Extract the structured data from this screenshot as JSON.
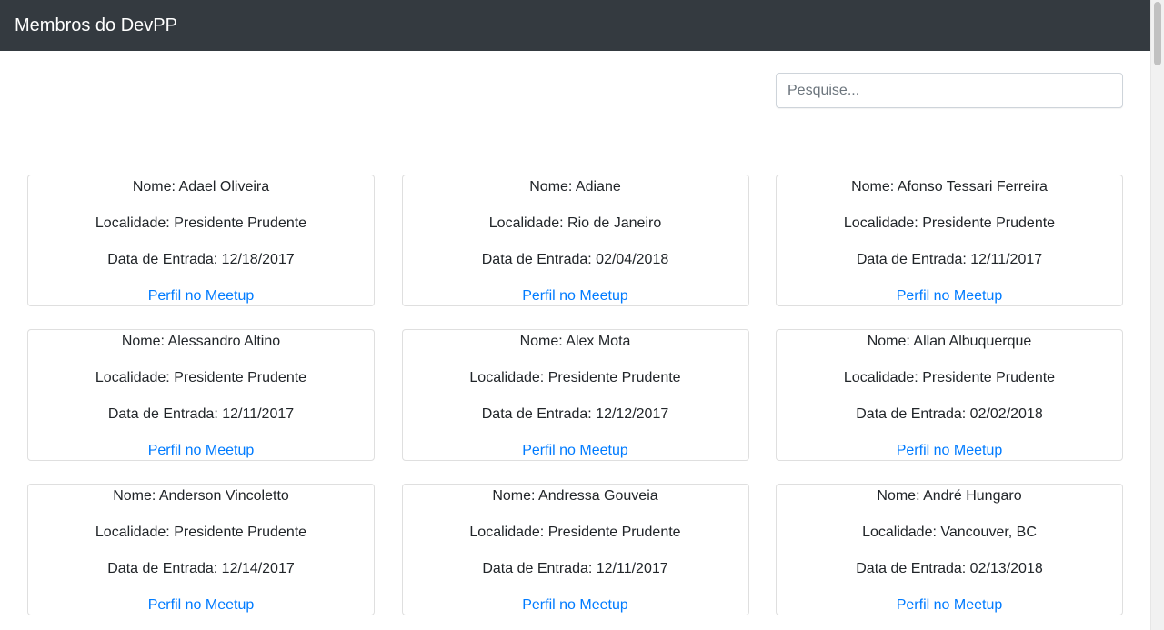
{
  "navbar": {
    "brand": "Membros do DevPP"
  },
  "search": {
    "placeholder": "Pesquise..."
  },
  "members": [
    {
      "name": "Nome: Adael Oliveira",
      "location": "Localidade: Presidente Prudente",
      "joined": "Data de Entrada: 12/18/2017",
      "link": "Perfil no Meetup"
    },
    {
      "name": "Nome: Adiane",
      "location": "Localidade: Rio de Janeiro",
      "joined": "Data de Entrada: 02/04/2018",
      "link": "Perfil no Meetup"
    },
    {
      "name": "Nome: Afonso Tessari Ferreira",
      "location": "Localidade: Presidente Prudente",
      "joined": "Data de Entrada: 12/11/2017",
      "link": "Perfil no Meetup"
    },
    {
      "name": "Nome: Alessandro Altino",
      "location": "Localidade: Presidente Prudente",
      "joined": "Data de Entrada: 12/11/2017",
      "link": "Perfil no Meetup"
    },
    {
      "name": "Nome: Alex Mota",
      "location": "Localidade: Presidente Prudente",
      "joined": "Data de Entrada: 12/12/2017",
      "link": "Perfil no Meetup"
    },
    {
      "name": "Nome: Allan Albuquerque",
      "location": "Localidade: Presidente Prudente",
      "joined": "Data de Entrada: 02/02/2018",
      "link": "Perfil no Meetup"
    },
    {
      "name": "Nome: Anderson Vincoletto",
      "location": "Localidade: Presidente Prudente",
      "joined": "Data de Entrada: 12/14/2017",
      "link": "Perfil no Meetup"
    },
    {
      "name": "Nome: Andressa Gouveia",
      "location": "Localidade: Presidente Prudente",
      "joined": "Data de Entrada: 12/11/2017",
      "link": "Perfil no Meetup"
    },
    {
      "name": "Nome: André Hungaro",
      "location": "Localidade: Vancouver, BC",
      "joined": "Data de Entrada: 02/13/2018",
      "link": "Perfil no Meetup"
    }
  ]
}
